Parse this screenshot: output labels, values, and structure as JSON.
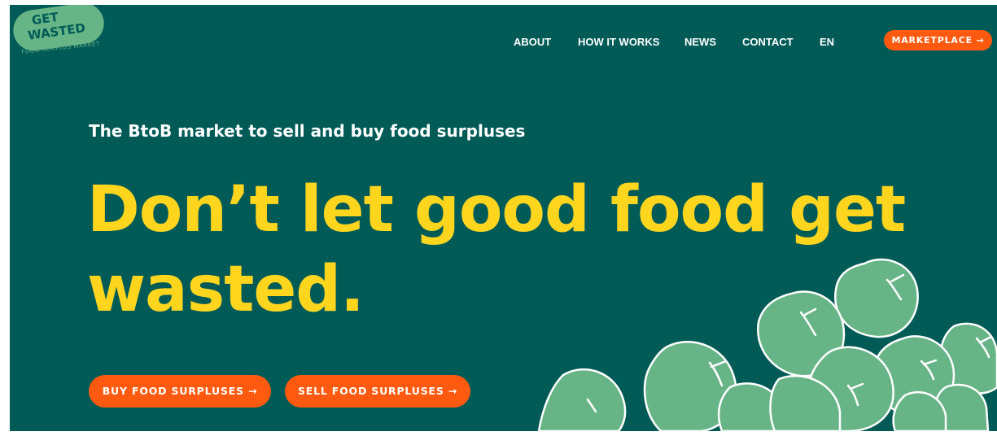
{
  "logo": {
    "line1": "GET",
    "line2": "WASTED",
    "tagline": "FOOD SURPLUS MARKET"
  },
  "nav": {
    "items": [
      {
        "label": "ABOUT"
      },
      {
        "label": "HOW IT WORKS"
      },
      {
        "label": "NEWS"
      },
      {
        "label": "CONTACT"
      },
      {
        "label": "EN"
      }
    ],
    "marketplace_label": "MARKETPLACE →"
  },
  "hero": {
    "subtitle": "The BtoB market to sell and buy food surpluses",
    "headline": "Don’t let good food get wasted.",
    "buy_label": "BUY FOOD SURPLUSES →",
    "sell_label": "SELL FOOD SURPLUSES →"
  },
  "colors": {
    "background": "#005b57",
    "accent_orange": "#ff5a0f",
    "headline_yellow": "#ffd51e",
    "apple_green": "#67b487"
  },
  "illustration": "apples-icon"
}
